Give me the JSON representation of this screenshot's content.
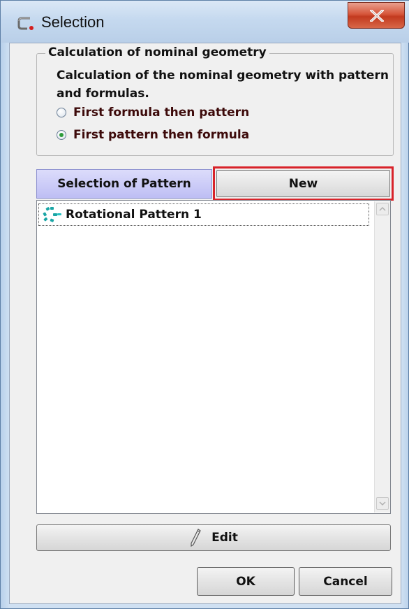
{
  "window": {
    "title": "Selection",
    "icons": {
      "app": "selection-app-icon",
      "close": "close-x-icon"
    }
  },
  "group": {
    "legend": "Calculation of nominal geometry",
    "description": "Calculation of the nominal geometry with pattern and formulas.",
    "options": [
      {
        "label": "First formula then pattern",
        "checked": false
      },
      {
        "label": "First pattern then formula",
        "checked": true
      }
    ]
  },
  "tabs": {
    "pattern_label": "Selection of Pattern",
    "new_label": "New",
    "new_highlight_color": "#d8232a"
  },
  "list": {
    "items": [
      {
        "label": "Rotational Pattern 1",
        "icon": "rotational-pattern-icon"
      }
    ]
  },
  "buttons": {
    "edit_label": "Edit",
    "edit_icon": "pencil-icon",
    "ok_label": "OK",
    "cancel_label": "Cancel"
  },
  "colors": {
    "tab_active_bg": "#bebef4",
    "radio_dot": "#2e9b3a",
    "option_text": "#3d0a0a",
    "titlebar": "#c5d9ef"
  }
}
